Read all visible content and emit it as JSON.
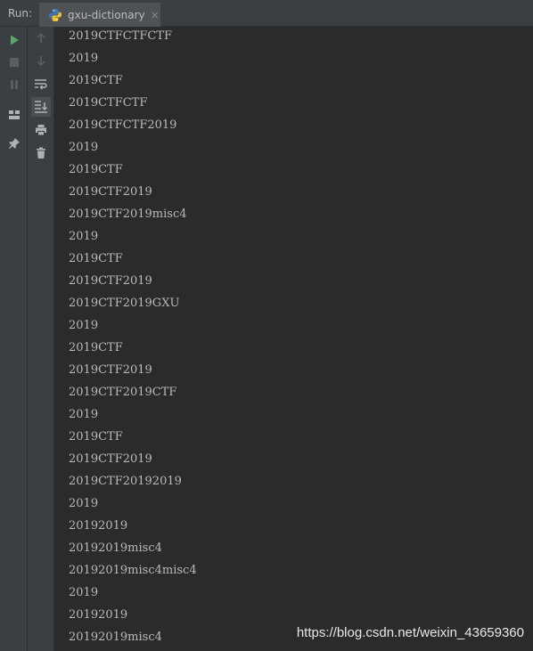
{
  "toolbar": {
    "run_label": "Run:"
  },
  "tab": {
    "title": "gxu-dictionary",
    "close": "×"
  },
  "icons": {
    "run": "play-icon",
    "stop": "stop-icon",
    "pause": "pause-icon",
    "layout": "layout-icon",
    "pin": "pin-icon",
    "up": "arrow-up-icon",
    "down": "arrow-down-icon",
    "wrap": "soft-wrap-icon",
    "scroll": "scroll-to-end-icon",
    "print": "print-icon",
    "trash": "trash-icon"
  },
  "colors": {
    "run_green": "#59a869",
    "console_bg": "#2b2b2b",
    "text": "#bababa"
  },
  "console": {
    "lines": [
      "2019CTFCTFCTF",
      "2019",
      "2019CTF",
      "2019CTFCTF",
      "2019CTFCTF2019",
      "2019",
      "2019CTF",
      "2019CTF2019",
      "2019CTF2019misc4",
      "2019",
      "2019CTF",
      "2019CTF2019",
      "2019CTF2019GXU",
      "2019",
      "2019CTF",
      "2019CTF2019",
      "2019CTF2019CTF",
      "2019",
      "2019CTF",
      "2019CTF2019",
      "2019CTF20192019",
      "2019",
      "20192019",
      "20192019misc4",
      "20192019misc4misc4",
      "2019",
      "20192019",
      "20192019misc4"
    ]
  },
  "watermark": "https://blog.csdn.net/weixin_43659360"
}
